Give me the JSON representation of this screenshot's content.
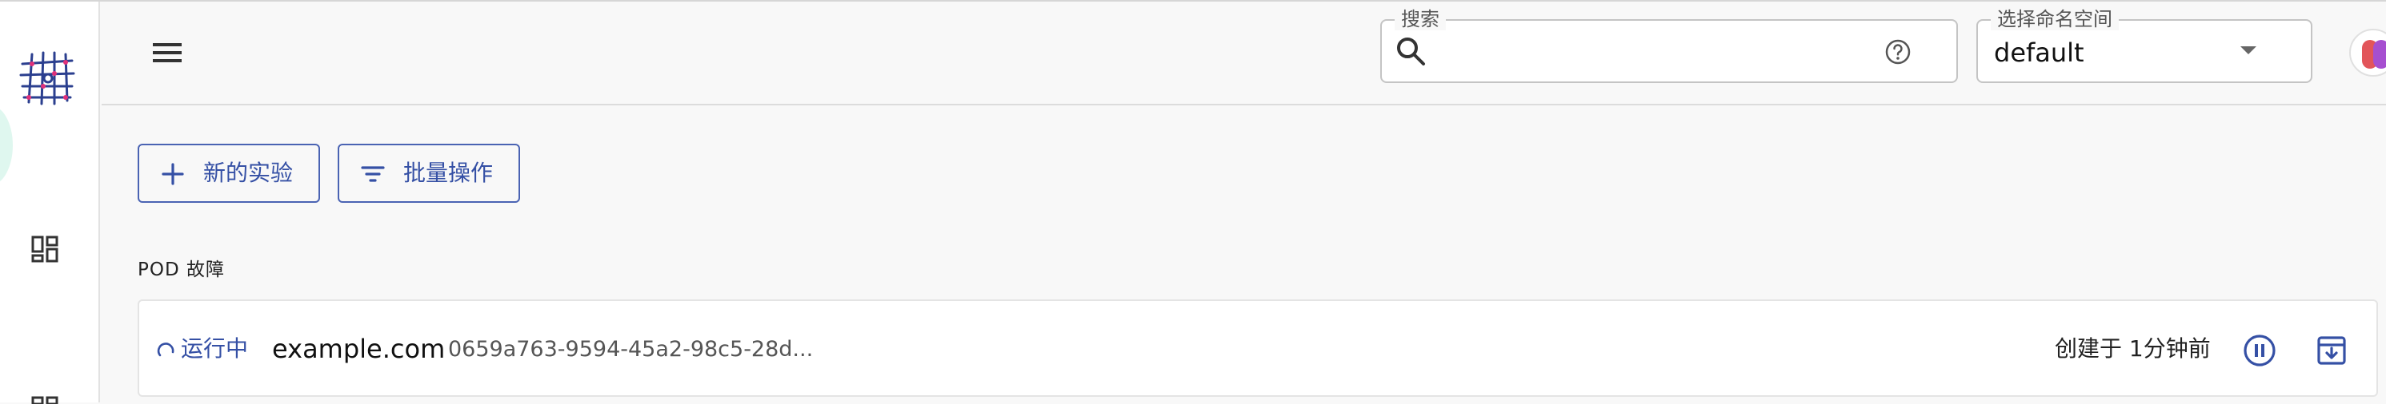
{
  "header": {
    "search": {
      "label": "搜索",
      "value": ""
    },
    "namespace": {
      "label": "选择命名空间",
      "value": "default"
    }
  },
  "sidebar": {
    "icons": [
      "mesh-logo-icon",
      "dashboard-icon"
    ]
  },
  "toolbar": {
    "new_experiment_label": "新的实验",
    "batch_operation_label": "批量操作"
  },
  "section": {
    "title": "POD 故障"
  },
  "experiment": {
    "status": "运行中",
    "name": "example.com",
    "uid": "0659a763-9594-45a2-98c5-28d...",
    "created": "创建于 1分钟前"
  },
  "colors": {
    "accent": "#3550a5",
    "border": "#c4c4c4",
    "background": "#f8f8f8"
  }
}
